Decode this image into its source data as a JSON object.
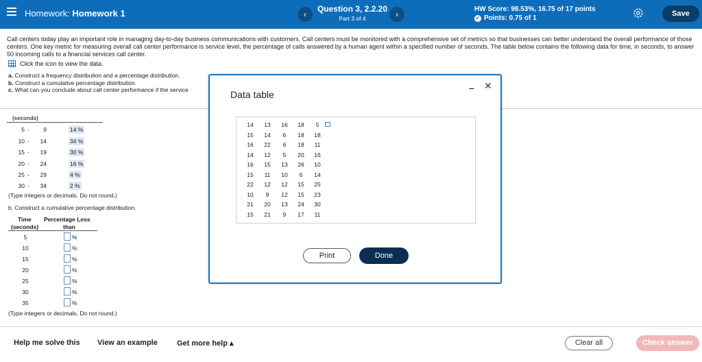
{
  "header": {
    "menu_icon": "hamburger-icon",
    "hw_prefix": "Homework:",
    "hw_name": "Homework 1",
    "question_title": "Question 3, 2.2.20",
    "question_part": "Part 3 of 4",
    "prev_icon": "chevron-left-icon",
    "next_icon": "chevron-right-icon",
    "hw_score": "HW Score: 98.53%, 16.75 of 17 points",
    "points": "Points: 0.75 of 1",
    "save_label": "Save"
  },
  "question": {
    "text": "Call centers today play an important role in managing day-to-day business communications with customers. Call centers must be monitored with a comprehensive set of metrics so that businesses can better understand the overall performance of those centers. One key metric for measuring overall call center performance is service level, the percentage of calls answered by a human agent within a specified number of seconds. The table below contains the following data for time, in seconds, to answer 50 incoming calls to a financial services call center.",
    "icon_line": "Click the icon to view the data.",
    "part_a": "Construct a frequency distribution and a percentage distribution.",
    "part_b": "Construct a cumulative percentage distribution.",
    "part_c": "What can you conclude about call center performance if the service"
  },
  "part_a": {
    "header_fragment": "(seconds)",
    "rows": [
      {
        "lo": "5",
        "hi": "9",
        "pct": "14 %"
      },
      {
        "lo": "10",
        "hi": "14",
        "pct": "34 %"
      },
      {
        "lo": "15",
        "hi": "19",
        "pct": "30 %"
      },
      {
        "lo": "20",
        "hi": "24",
        "pct": "16 %"
      },
      {
        "lo": "25",
        "hi": "29",
        "pct": "4 %"
      },
      {
        "lo": "30",
        "hi": "34",
        "pct": "2 %"
      }
    ],
    "hint": "(Type integers or decimals. Do not round.)"
  },
  "part_b": {
    "title": "b. Construct a cumulative percentage distribution.",
    "col_time": "Time",
    "col_seconds": "(seconds)",
    "col_pct": "Percentage Less",
    "col_than": "than",
    "times": [
      "5",
      "10",
      "15",
      "20",
      "25",
      "30",
      "35"
    ],
    "pct_symbol": "%",
    "hint": "(Type integers or decimals. Do not round.)"
  },
  "dialog": {
    "title": "Data table",
    "minimize_icon": "minimize-icon",
    "close_icon": "close-icon",
    "rows": [
      [
        "14",
        "13",
        "16",
        "18",
        "5"
      ],
      [
        "15",
        "14",
        "6",
        "18",
        "18"
      ],
      [
        "16",
        "22",
        "6",
        "18",
        "11"
      ],
      [
        "14",
        "12",
        "5",
        "20",
        "16"
      ],
      [
        "16",
        "15",
        "13",
        "26",
        "10"
      ],
      [
        "15",
        "11",
        "10",
        "6",
        "14"
      ],
      [
        "22",
        "12",
        "12",
        "15",
        "25"
      ],
      [
        "10",
        "9",
        "12",
        "15",
        "23"
      ],
      [
        "21",
        "20",
        "13",
        "24",
        "30"
      ],
      [
        "15",
        "21",
        "9",
        "17",
        "11"
      ]
    ],
    "print_label": "Print",
    "done_label": "Done"
  },
  "footer": {
    "help": "Help me solve this",
    "example": "View an example",
    "more_help": "Get more help ▴",
    "clear": "Clear all",
    "check": "Check answer"
  },
  "colors": {
    "header_blue": "#0e6dbb",
    "save_dark": "#0b3d66",
    "done_dark": "#0b2f52",
    "check_disabled": "#f2b8b8"
  }
}
